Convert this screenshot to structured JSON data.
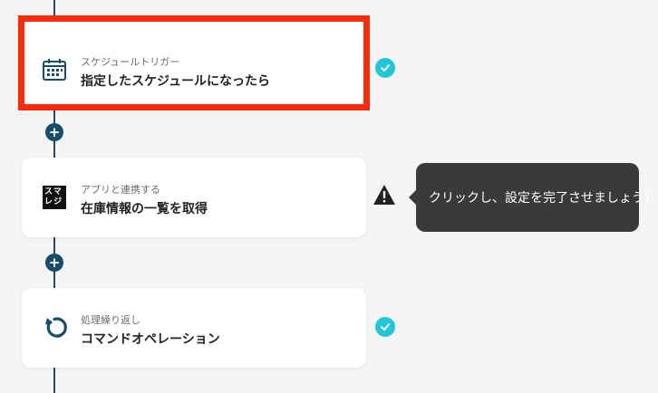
{
  "flow": {
    "steps": [
      {
        "subtitle": "スケジュールトリガー",
        "title": "指定したスケジュールになったら",
        "icon": "calendar-schedule-icon",
        "status": "complete"
      },
      {
        "subtitle": "アプリと連携する",
        "title": "在庫情報の一覧を取得",
        "icon": "smaregi-logo",
        "logo_text": "スマレジ",
        "status": "warning"
      },
      {
        "subtitle": "処理繰り返し",
        "title": "コマンドオペレーション",
        "icon": "loop-icon",
        "status": "complete"
      }
    ],
    "add_step_label": "+",
    "tooltip": "クリックし、設定を完了させましょう！"
  },
  "colors": {
    "highlight_border": "#ff2a0a",
    "connector": "#1f4e6b",
    "check": "#1fc7d8",
    "tooltip_bg": "#3a3a3a"
  }
}
